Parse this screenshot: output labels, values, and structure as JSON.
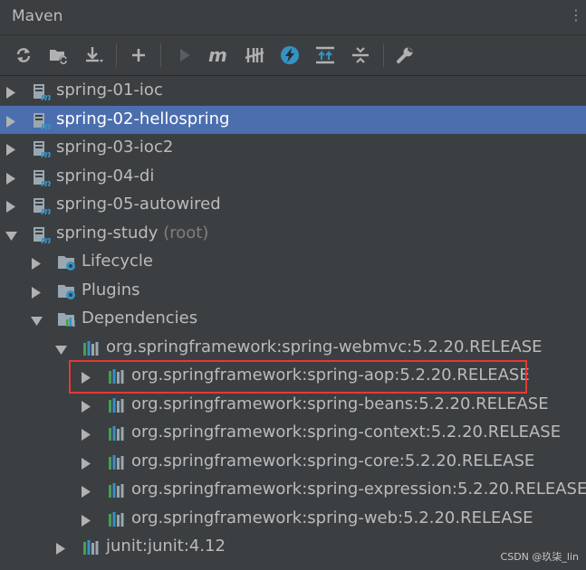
{
  "header": {
    "title": "Maven",
    "menu_glyph": "⋮"
  },
  "toolbar": {
    "buttons": [
      {
        "icon": "refresh-icon"
      },
      {
        "icon": "folder-refresh-icon"
      },
      {
        "icon": "download-icon"
      },
      {
        "icon": "plus-icon"
      },
      {
        "icon": "run-icon"
      },
      {
        "icon": "maven-goal-icon"
      },
      {
        "icon": "toggle-offline-icon"
      },
      {
        "icon": "skip-tests-icon"
      },
      {
        "icon": "show-dependencies-icon"
      },
      {
        "icon": "collapse-all-icon"
      },
      {
        "icon": "settings-wrench-icon"
      }
    ]
  },
  "tree": {
    "projects": [
      {
        "label": "spring-01-ioc",
        "selected": false
      },
      {
        "label": "spring-02-hellospring",
        "selected": true
      },
      {
        "label": "spring-03-ioc2",
        "selected": false
      },
      {
        "label": "spring-04-di",
        "selected": false
      },
      {
        "label": "spring-05-autowired",
        "selected": false
      }
    ],
    "root": {
      "label": "spring-study",
      "suffix": "(root)"
    },
    "root_children": [
      {
        "label": "Lifecycle"
      },
      {
        "label": "Plugins"
      },
      {
        "label": "Dependencies"
      }
    ],
    "webmvc": {
      "label": "org.springframework:spring-webmvc:5.2.20.RELEASE"
    },
    "webmvc_children": [
      {
        "label": "org.springframework:spring-aop:5.2.20.RELEASE"
      },
      {
        "label": "org.springframework:spring-beans:5.2.20.RELEASE"
      },
      {
        "label": "org.springframework:spring-context:5.2.20.RELEASE"
      },
      {
        "label": "org.springframework:spring-core:5.2.20.RELEASE"
      },
      {
        "label": "org.springframework:spring-expression:5.2.20.RELEASE"
      },
      {
        "label": "org.springframework:spring-web:5.2.20.RELEASE"
      }
    ],
    "junit": {
      "label": "junit:junit:4.12"
    }
  },
  "watermark": "CSDN @玖柒_lin",
  "colors": {
    "panel_bg": "#3c3f41",
    "selection": "#4b6eaf",
    "text": "#bbbbbb",
    "highlight_border": "#e53935"
  }
}
